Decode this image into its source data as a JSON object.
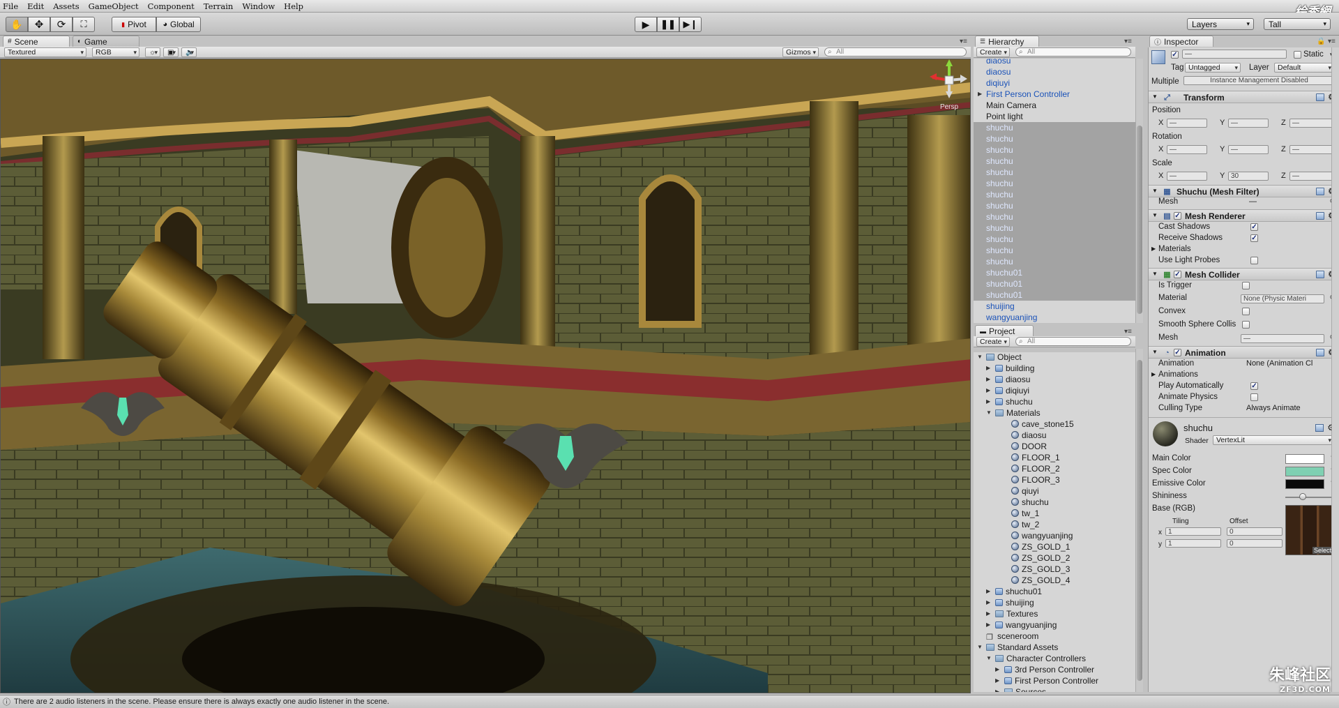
{
  "logo_text": "绘秀網",
  "menu": [
    "File",
    "Edit",
    "Assets",
    "GameObject",
    "Component",
    "Terrain",
    "Window",
    "Help"
  ],
  "toolbar": {
    "pivot_label": "Pivot",
    "global_label": "Global",
    "layers_label": "Layers",
    "layout_label": "Tall"
  },
  "scene_panel": {
    "tab_scene": "Scene",
    "tab_game": "Game",
    "render_mode": "Textured",
    "color_mode": "RGB",
    "gizmos_label": "Gizmos",
    "search_placeholder": "All",
    "gizmo_label": "Persp"
  },
  "hierarchy": {
    "title": "Hierarchy",
    "create_label": "Create",
    "search_placeholder": "All",
    "items": [
      {
        "label": "diaosu",
        "type": "prefab"
      },
      {
        "label": "diaosu",
        "type": "prefab"
      },
      {
        "label": "diqiuyi",
        "type": "prefab"
      },
      {
        "label": "First Person Controller",
        "type": "prefab",
        "expandable": true
      },
      {
        "label": "Main Camera",
        "type": "normal"
      },
      {
        "label": "Point light",
        "type": "normal"
      },
      {
        "label": "shuchu",
        "type": "sel"
      },
      {
        "label": "shuchu",
        "type": "sel"
      },
      {
        "label": "shuchu",
        "type": "sel"
      },
      {
        "label": "shuchu",
        "type": "sel"
      },
      {
        "label": "shuchu",
        "type": "sel"
      },
      {
        "label": "shuchu",
        "type": "sel"
      },
      {
        "label": "shuchu",
        "type": "sel"
      },
      {
        "label": "shuchu",
        "type": "sel"
      },
      {
        "label": "shuchu",
        "type": "sel"
      },
      {
        "label": "shuchu",
        "type": "sel"
      },
      {
        "label": "shuchu",
        "type": "sel"
      },
      {
        "label": "shuchu",
        "type": "sel"
      },
      {
        "label": "shuchu",
        "type": "sel"
      },
      {
        "label": "shuchu01",
        "type": "sel"
      },
      {
        "label": "shuchu01",
        "type": "sel"
      },
      {
        "label": "shuchu01",
        "type": "sel"
      },
      {
        "label": "shuijing",
        "type": "prefab"
      },
      {
        "label": "wangyuanjing",
        "type": "prefab"
      }
    ]
  },
  "project": {
    "title": "Project",
    "create_label": "Create",
    "search_placeholder": "All",
    "items": [
      {
        "label": "Object",
        "kind": "folder",
        "depth": 0,
        "open": true
      },
      {
        "label": "building",
        "kind": "prefab",
        "depth": 1,
        "arrow": true
      },
      {
        "label": "diaosu",
        "kind": "prefab",
        "depth": 1,
        "arrow": true
      },
      {
        "label": "diqiuyi",
        "kind": "prefab",
        "depth": 1,
        "arrow": true
      },
      {
        "label": "shuchu",
        "kind": "prefab",
        "depth": 1,
        "arrow": true
      },
      {
        "label": "Materials",
        "kind": "folder",
        "depth": 1,
        "open": true
      },
      {
        "label": "cave_stone15",
        "kind": "mat",
        "depth": 2
      },
      {
        "label": "diaosu",
        "kind": "mat",
        "depth": 2
      },
      {
        "label": "DOOR",
        "kind": "mat",
        "depth": 2
      },
      {
        "label": "FLOOR_1",
        "kind": "mat",
        "depth": 2
      },
      {
        "label": "FLOOR_2",
        "kind": "mat",
        "depth": 2
      },
      {
        "label": "FLOOR_3",
        "kind": "mat",
        "depth": 2
      },
      {
        "label": "qiuyi",
        "kind": "mat",
        "depth": 2
      },
      {
        "label": "shuchu",
        "kind": "mat",
        "depth": 2
      },
      {
        "label": "tw_1",
        "kind": "mat",
        "depth": 2
      },
      {
        "label": "tw_2",
        "kind": "mat",
        "depth": 2
      },
      {
        "label": "wangyuanjing",
        "kind": "mat",
        "depth": 2
      },
      {
        "label": "ZS_GOLD_1",
        "kind": "mat",
        "depth": 2
      },
      {
        "label": "ZS_GOLD_2",
        "kind": "mat",
        "depth": 2
      },
      {
        "label": "ZS_GOLD_3",
        "kind": "mat",
        "depth": 2
      },
      {
        "label": "ZS_GOLD_4",
        "kind": "mat",
        "depth": 2
      },
      {
        "label": "shuchu01",
        "kind": "prefab",
        "depth": 1,
        "arrow": true
      },
      {
        "label": "shuijing",
        "kind": "prefab",
        "depth": 1,
        "arrow": true
      },
      {
        "label": "Textures",
        "kind": "folder",
        "depth": 1,
        "arrow": true
      },
      {
        "label": "wangyuanjing",
        "kind": "prefab",
        "depth": 1,
        "arrow": true
      },
      {
        "label": "sceneroom",
        "kind": "scene",
        "depth": 0
      },
      {
        "label": "Standard Assets",
        "kind": "folder",
        "depth": 0,
        "open": true
      },
      {
        "label": "Character Controllers",
        "kind": "folder",
        "depth": 1,
        "open": true
      },
      {
        "label": "3rd Person Controller",
        "kind": "prefab",
        "depth": 2,
        "arrow": true
      },
      {
        "label": "First Person Controller",
        "kind": "prefab",
        "depth": 2,
        "arrow": true
      },
      {
        "label": "Sources",
        "kind": "folder",
        "depth": 2,
        "arrow": true
      }
    ]
  },
  "inspector": {
    "title": "Inspector",
    "name_value": "—",
    "static_label": "Static",
    "tag_label": "Tag",
    "tag_value": "Untagged",
    "layer_label": "Layer",
    "layer_value": "Default",
    "multiple_label": "Multiple",
    "multiple_value": "Instance Management Disabled",
    "transform": {
      "title": "Transform",
      "position_label": "Position",
      "rotation_label": "Rotation",
      "scale_label": "Scale",
      "x": "X",
      "y": "Y",
      "z": "Z",
      "dash": "—",
      "scale_y": "30"
    },
    "mesh_filter": {
      "title": "Shuchu (Mesh Filter)",
      "mesh_label": "Mesh",
      "mesh_value": "—"
    },
    "mesh_renderer": {
      "title": "Mesh Renderer",
      "cast_shadows": "Cast Shadows",
      "receive_shadows": "Receive Shadows",
      "materials": "Materials",
      "use_light_probes": "Use Light Probes"
    },
    "mesh_collider": {
      "title": "Mesh Collider",
      "is_trigger": "Is Trigger",
      "material_label": "Material",
      "material_value": "None (Physic Materi",
      "convex": "Convex",
      "smooth": "Smooth Sphere Collis",
      "mesh_label": "Mesh",
      "mesh_value": "—"
    },
    "animation": {
      "title": "Animation",
      "animation_label": "Animation",
      "animation_value": "None (Animation Cl",
      "animations": "Animations",
      "play_auto": "Play Automatically",
      "animate_physics": "Animate Physics",
      "culling_label": "Culling Type",
      "culling_value": "Always Animate"
    },
    "material": {
      "name": "shuchu",
      "shader_label": "Shader",
      "shader_value": "VertexLit",
      "main_color": "Main Color",
      "spec_color": "Spec Color",
      "emissive_color": "Emissive Color",
      "shininess": "Shininess",
      "base": "Base (RGB)",
      "tiling": "Tiling",
      "offset": "Offset",
      "x": "x",
      "y": "y",
      "tile_x": "1",
      "tile_y": "1",
      "off_x": "0",
      "off_y": "0",
      "select": "Select",
      "main_hex": "#ffffff",
      "spec_hex": "#7fd0b2",
      "emis_hex": "#0a0a0a"
    }
  },
  "status": "There are 2 audio listeners in the scene. Please ensure there is always exactly one audio listener in the scene.",
  "watermark": {
    "main": "朱峰社区",
    "sub": "ZF3D.COM"
  }
}
